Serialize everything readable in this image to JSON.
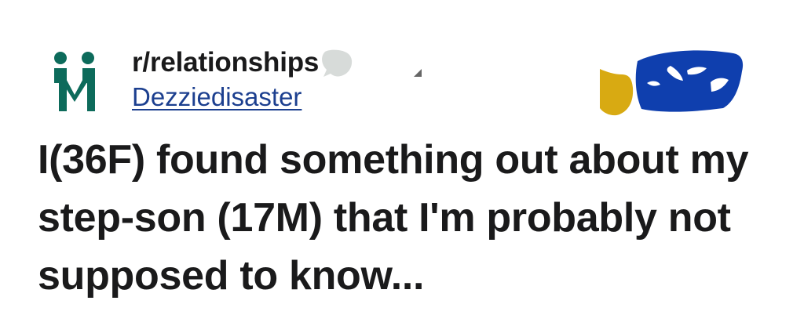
{
  "post": {
    "subreddit": "r/relationships",
    "author": "Dezziedisaster",
    "title": "I(36F) found something out about my step-son (17M) that I'm probably not supposed to know..."
  },
  "icons": {
    "subreddit_icon": "two-people-icon",
    "speech_bubble": "speech-bubble-icon",
    "caret": "caret-icon",
    "award": "award-icon"
  },
  "colors": {
    "subreddit_icon": "#0d6b5b",
    "link": "#1c3f8f",
    "award_blue": "#0f3fae",
    "award_gold": "#d8aa12",
    "bubble_gray": "#d7dbd9"
  }
}
